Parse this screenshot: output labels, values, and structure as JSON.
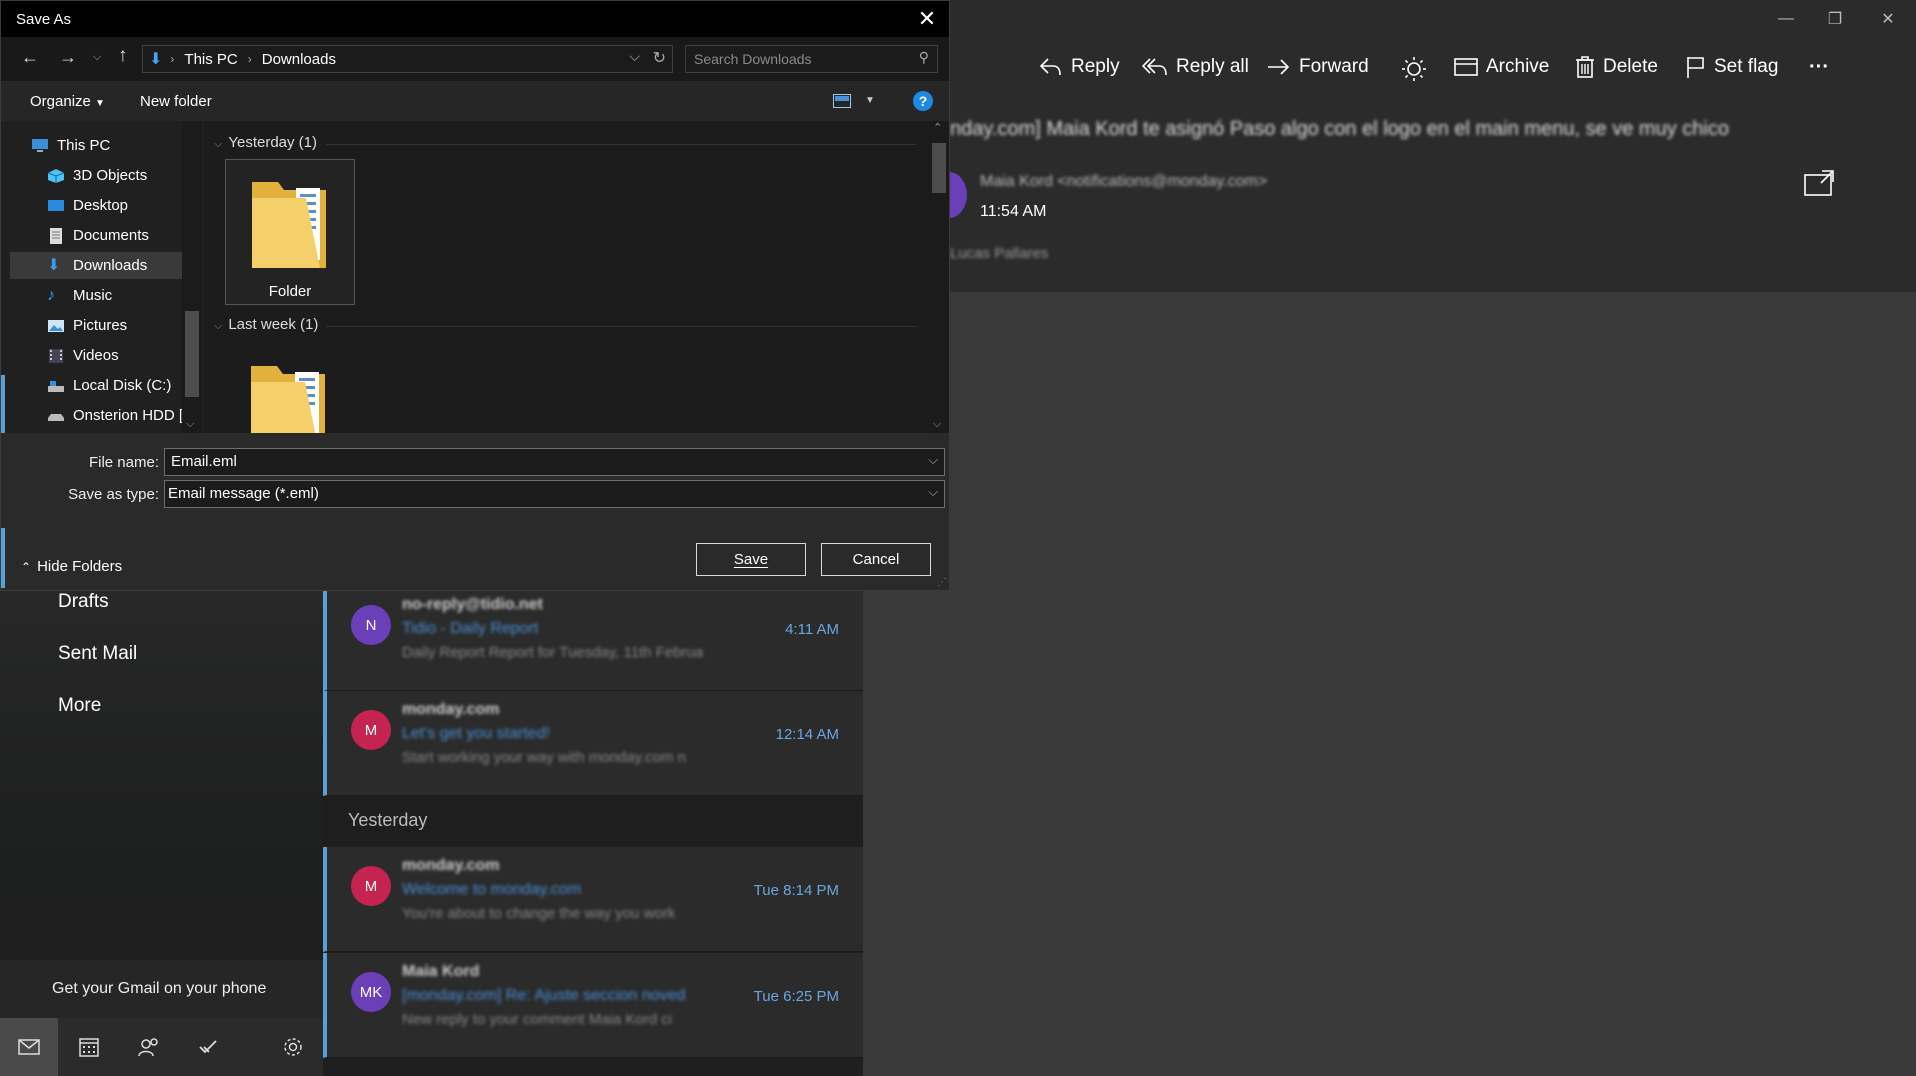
{
  "mail_nav": {
    "drafts": "Drafts",
    "sent_mail": "Sent Mail",
    "more": "More",
    "gmail_promo": "Get your Gmail on your phone"
  },
  "messages": [
    {
      "initial": "N",
      "color": "#6b3fb8",
      "sender": "no-reply@tidio.net",
      "subject": "Tidio - Daily Report",
      "preview": "Daily Report Report for Tuesday, 11th Februa",
      "time": "4:11 AM"
    },
    {
      "initial": "M",
      "color": "#c4244f",
      "sender": "monday.com",
      "subject": "Let's get you started!",
      "preview": "Start working your way with monday.com n",
      "time": "12:14 AM"
    },
    {
      "initial": "M",
      "color": "#c4244f",
      "sender": "monday.com",
      "subject": "Welcome to monday.com",
      "preview": "You're about to change the way you work",
      "time": "Tue 8:14 PM"
    },
    {
      "initial": "MK",
      "color": "#6b3fb8",
      "sender": "Maia Kord",
      "subject": "[monday.com] Re: Ajuste seccion noved",
      "preview": "New reply to your comment Maia Kord ci",
      "time": "Tue 6:25 PM"
    }
  ],
  "list_group_yesterday": "Yesterday",
  "reading": {
    "toolbar": {
      "reply": "Reply",
      "reply_all": "Reply all",
      "forward": "Forward",
      "archive": "Archive",
      "delete": "Delete",
      "set_flag": "Set flag",
      "more": "···"
    },
    "subject": "nday.com] Maia Kord te asignó Paso algo con el logo en el main menu, se ve muy chico",
    "from": "Maia Kord <notifications@monday.com>",
    "time": "11:54 AM",
    "to": "Lucas Pallares"
  },
  "dialog": {
    "title": "Save As",
    "close": "✕",
    "breadcrumb": [
      "This PC",
      "Downloads"
    ],
    "search_placeholder": "Search Downloads",
    "organize": "Organize",
    "new_folder": "New folder",
    "help": "?",
    "tree": [
      "This PC",
      "3D Objects",
      "Desktop",
      "Documents",
      "Downloads",
      "Music",
      "Pictures",
      "Videos",
      "Local Disk (C:)",
      "Onsterion HDD ["
    ],
    "selected_tree_item": "Downloads",
    "groups": [
      {
        "label": "Yesterday (1)",
        "folder": "Folder"
      },
      {
        "label": "Last week (1)",
        "folder": ""
      }
    ],
    "file_name_label": "File name:",
    "file_name_value": "Email.eml",
    "save_type_label": "Save as type:",
    "save_type_value": "Email message (*.eml)",
    "hide_folders": "Hide Folders",
    "save": "Save",
    "cancel": "Cancel"
  }
}
